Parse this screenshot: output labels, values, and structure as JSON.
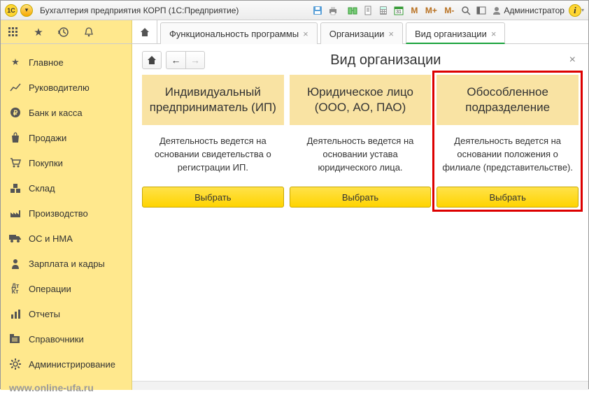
{
  "titleBar": {
    "appTitle": "Бухгалтерия предприятия КОРП  (1С:Предприятие)",
    "user": "Администратор",
    "textM": "M",
    "textMplus": "M+",
    "textMminus": "M-"
  },
  "tabs": [
    {
      "label": "Функциональность программы"
    },
    {
      "label": "Организации"
    },
    {
      "label": "Вид организации",
      "active": true
    }
  ],
  "sidebar": {
    "items": [
      {
        "label": "Главное"
      },
      {
        "label": "Руководителю"
      },
      {
        "label": "Банк и касса"
      },
      {
        "label": "Продажи"
      },
      {
        "label": "Покупки"
      },
      {
        "label": "Склад"
      },
      {
        "label": "Производство"
      },
      {
        "label": "ОС и НМА"
      },
      {
        "label": "Зарплата и кадры"
      },
      {
        "label": "Операции"
      },
      {
        "label": "Отчеты"
      },
      {
        "label": "Справочники"
      },
      {
        "label": "Администрирование"
      }
    ],
    "watermark": "www.online-ufa.ru"
  },
  "page": {
    "title": "Вид организации",
    "cards": [
      {
        "heading": "Индивидуальный предприниматель (ИП)",
        "desc": "Деятельность ведется на основании свидетельства о регистрации ИП.",
        "button": "Выбрать"
      },
      {
        "heading": "Юридическое лицо (ООО, АО, ПАО)",
        "desc": "Деятельность ведется на основании устава юридического лица.",
        "button": "Выбрать"
      },
      {
        "heading": "Обособленное подразделение",
        "desc": "Деятельность ведется на основании положения о филиале (представительстве).",
        "button": "Выбрать"
      }
    ]
  }
}
